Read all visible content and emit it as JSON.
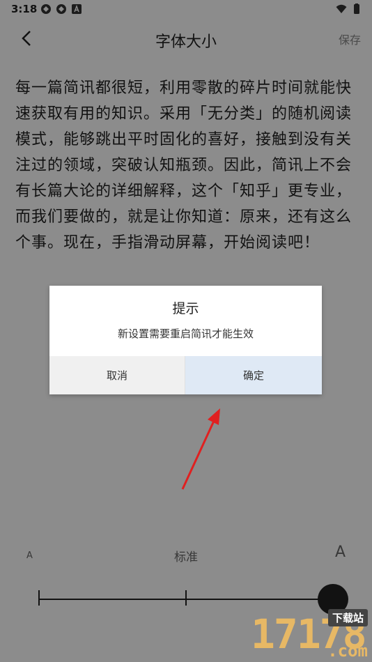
{
  "status_bar": {
    "time": "3:18",
    "icons_left": [
      "app-notification-icon",
      "app-notification-icon",
      "font-a-icon"
    ],
    "icons_right": [
      "wifi-icon",
      "battery-icon"
    ]
  },
  "app_bar": {
    "title": "字体大小",
    "save_label": "保存",
    "back_icon": "chevron-left-icon"
  },
  "article": {
    "text": "每一篇简讯都很短，利用零散的碎片时间就能快速获取有用的知识。采用「无分类」的随机阅读模式，能够跳出平时固化的喜好，接触到没有关注过的领域，突破认知瓶颈。因此，简讯上不会有长篇大论的详细解释，这个「知乎」更专业，而我们要做的，就是让你知道：原来，还有这么个事。现在，手指滑动屏幕，开始阅读吧！"
  },
  "font_slider": {
    "label_small": "A",
    "label_standard": "标准",
    "label_large": "A",
    "steps": 3,
    "selected_index": 2
  },
  "dialog": {
    "title": "提示",
    "message": "新设置需要重启简讯才能生效",
    "cancel_label": "取消",
    "confirm_label": "确定"
  },
  "watermark": {
    "digits": "17178",
    "suffix": ".com",
    "badge": "下载站"
  },
  "colors": {
    "overlay": "#000000",
    "confirm_bg": "#dfe9f5",
    "cancel_bg": "#f0f0f0",
    "arrow": "#e02020",
    "watermark": "#e7b865"
  }
}
